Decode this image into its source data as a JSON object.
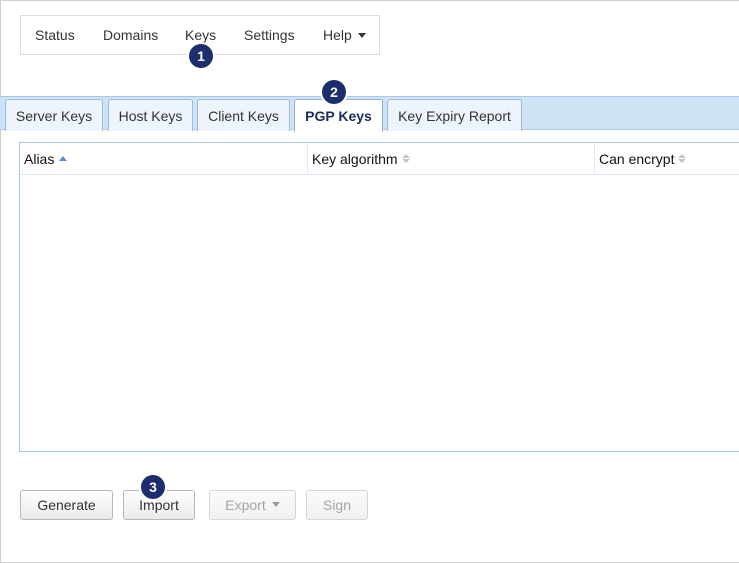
{
  "nav": {
    "items": [
      {
        "label": "Status"
      },
      {
        "label": "Domains"
      },
      {
        "label": "Keys"
      },
      {
        "label": "Settings"
      },
      {
        "label": "Help"
      }
    ]
  },
  "callouts": [
    "1",
    "2",
    "3"
  ],
  "tabs": [
    {
      "label": "Server Keys",
      "active": false
    },
    {
      "label": "Host Keys",
      "active": false
    },
    {
      "label": "Client Keys",
      "active": false
    },
    {
      "label": "PGP Keys",
      "active": true
    },
    {
      "label": "Key Expiry Report",
      "active": false
    }
  ],
  "table": {
    "columns": [
      {
        "label": "Alias",
        "sort": "ascending"
      },
      {
        "label": "Key algorithm",
        "sort": "none"
      },
      {
        "label": "Can encrypt",
        "sort": "none"
      }
    ],
    "rows": []
  },
  "actions": {
    "generate": "Generate",
    "import": "Import",
    "export": "Export",
    "sign": "Sign"
  },
  "colors": {
    "tab_bar_bg": "#cfe3f7",
    "callout_bg": "#1c2e6d",
    "active_tab_text": "#1d2d5a",
    "sort_active": "#5b8ed6"
  }
}
